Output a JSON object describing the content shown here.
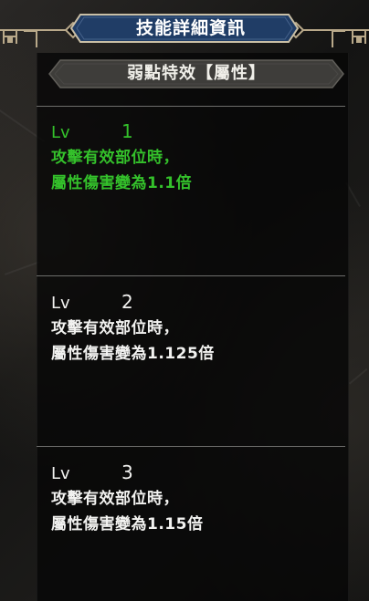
{
  "window": {
    "title": "技能詳細資訊"
  },
  "skill": {
    "name": "弱點特效【屬性】"
  },
  "levels": [
    {
      "label": "Lv",
      "number": "1",
      "line1": "攻擊有效部位時，",
      "line2": "屬性傷害變為1.1倍",
      "active": true
    },
    {
      "label": "Lv",
      "number": "2",
      "line1": "攻擊有效部位時，",
      "line2": "屬性傷害變為1.125倍",
      "active": false
    },
    {
      "label": "Lv",
      "number": "3",
      "line1": "攻擊有效部位時，",
      "line2": "屬性傷害變為1.15倍",
      "active": false
    }
  ],
  "colors": {
    "active_text": "#34c12b",
    "inactive_text": "#f2f2f0",
    "title_bar_blue": "#203d66",
    "frame_gold": "#b9a98a"
  }
}
